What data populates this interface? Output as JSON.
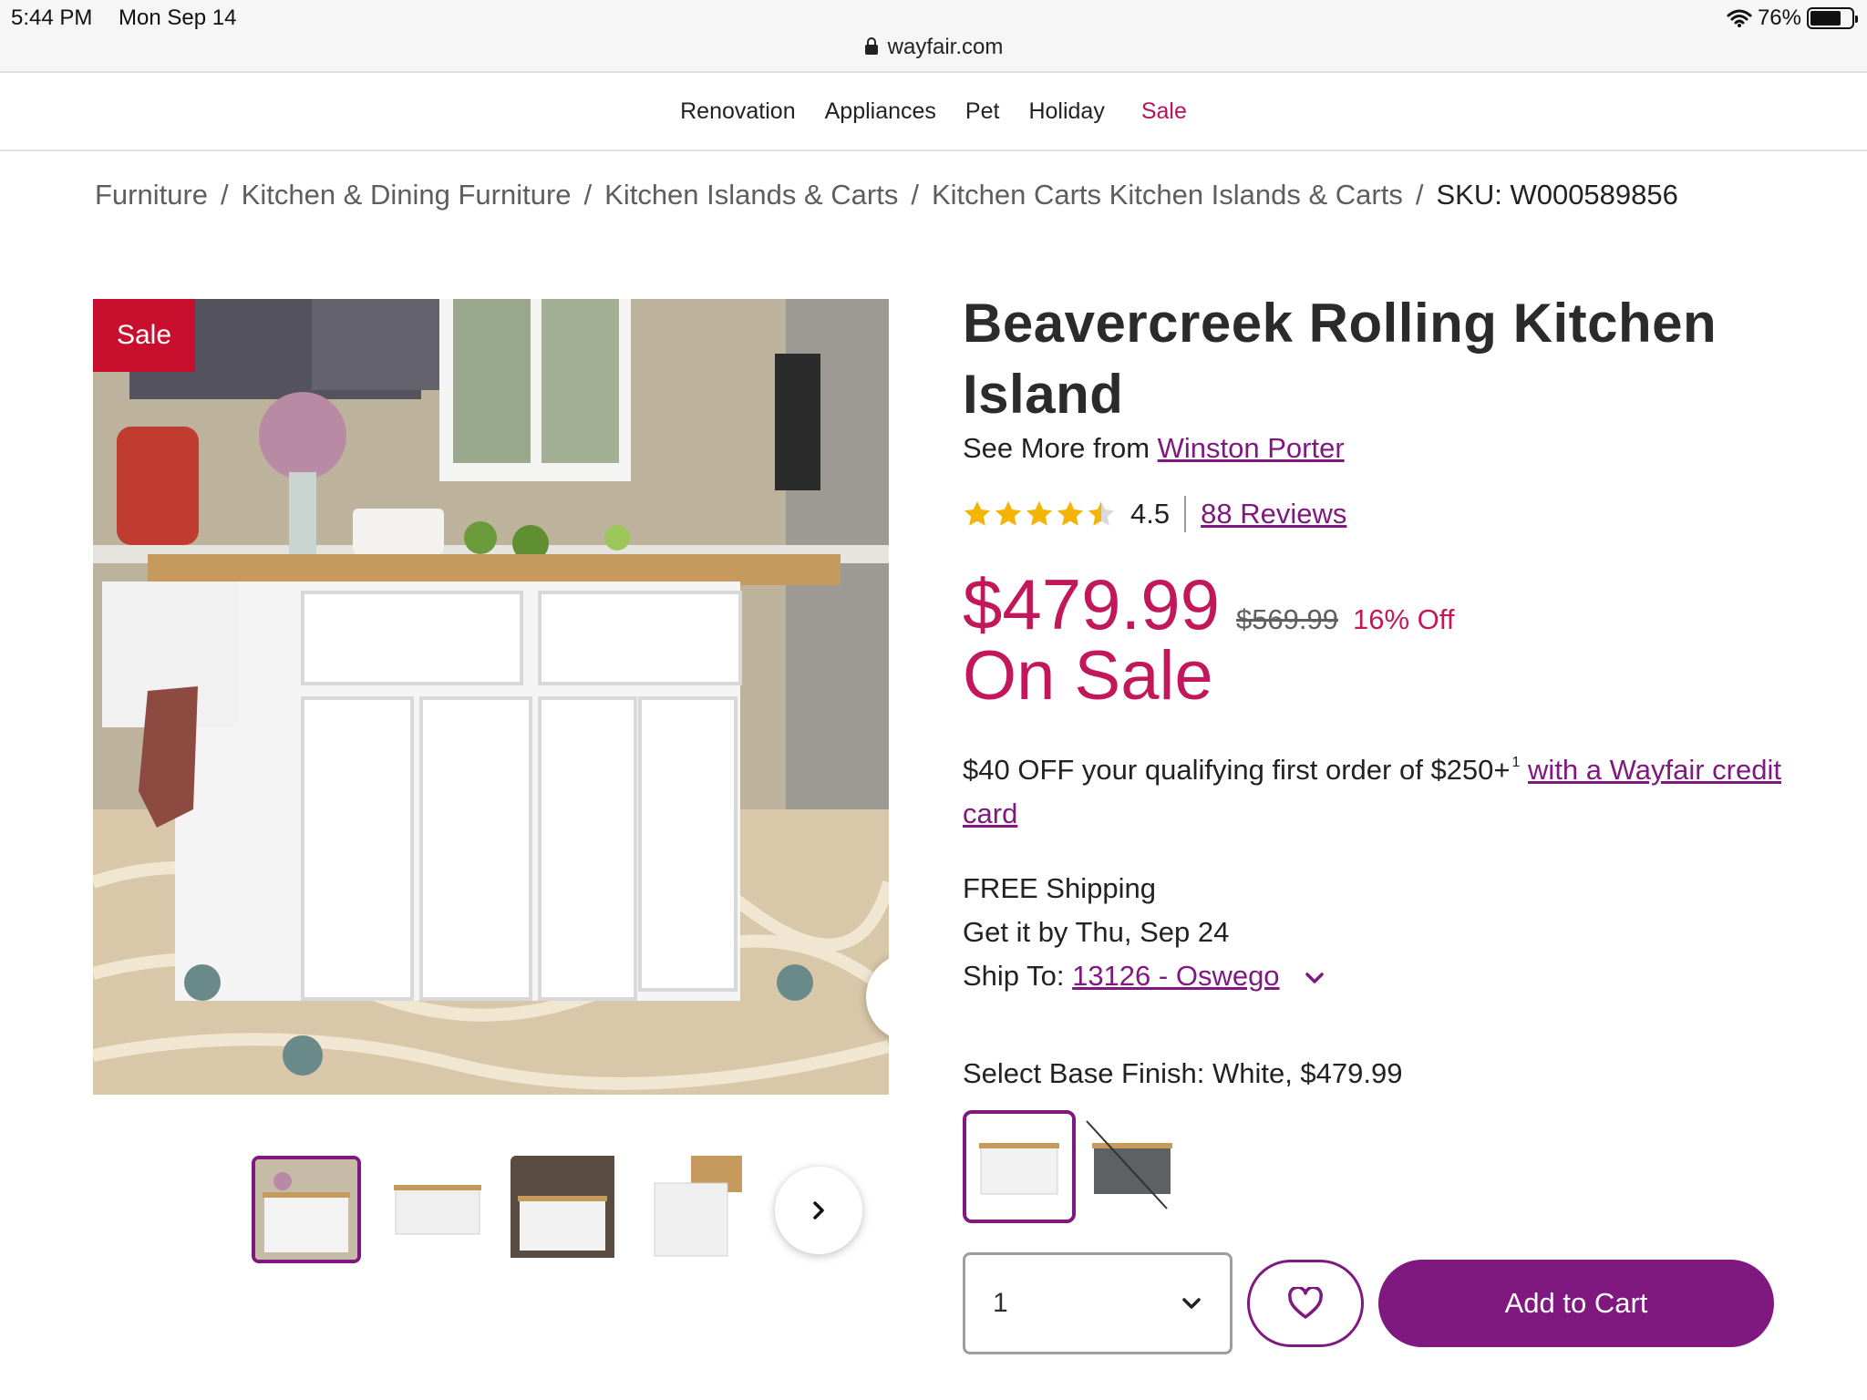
{
  "status_bar": {
    "time": "5:44 PM",
    "date": "Mon Sep 14",
    "url": "wayfair.com",
    "battery": "76%",
    "battery_level": 0.76
  },
  "nav": {
    "items": [
      "Renovation",
      "Appliances",
      "Pet",
      "Holiday",
      "Sale"
    ]
  },
  "breadcrumb": {
    "items": [
      "Furniture",
      "Kitchen & Dining Furniture",
      "Kitchen Islands & Carts",
      "Kitchen Carts Kitchen Islands & Carts"
    ],
    "separator": "/",
    "sku": "SKU: W000589856"
  },
  "gallery": {
    "sale_tag": "Sale",
    "next_icon": "chevron-right-icon",
    "thumbnail_count": 4
  },
  "product": {
    "title": "Beavercreek Rolling Kitchen Island",
    "see_more_prefix": "See More from",
    "brand": "Winston Porter",
    "rating": "4.5",
    "rating_value": 4.5,
    "reviews": "88 Reviews",
    "price": "$479.99",
    "original_price": "$569.99",
    "discount": "16% Off",
    "on_sale": "On Sale",
    "promo_text": "$40 OFF your qualifying first order of $250+",
    "promo_sup": "1",
    "promo_link": "with a Wayfair credit card",
    "shipping": "FREE Shipping",
    "delivery": "Get it by Thu, Sep 24",
    "ship_to_label": "Ship To:",
    "ship_to_value": "13126 - Oswego",
    "finish_label": "Select Base Finish: White, $479.99"
  },
  "cart": {
    "quantity": "1",
    "add_to_cart": "Add to Cart"
  },
  "colors": {
    "brand_purple": "#7f187f",
    "sale_pink": "#c2185b",
    "sale_tag_red": "#c8102e",
    "star": "#f4b400"
  }
}
